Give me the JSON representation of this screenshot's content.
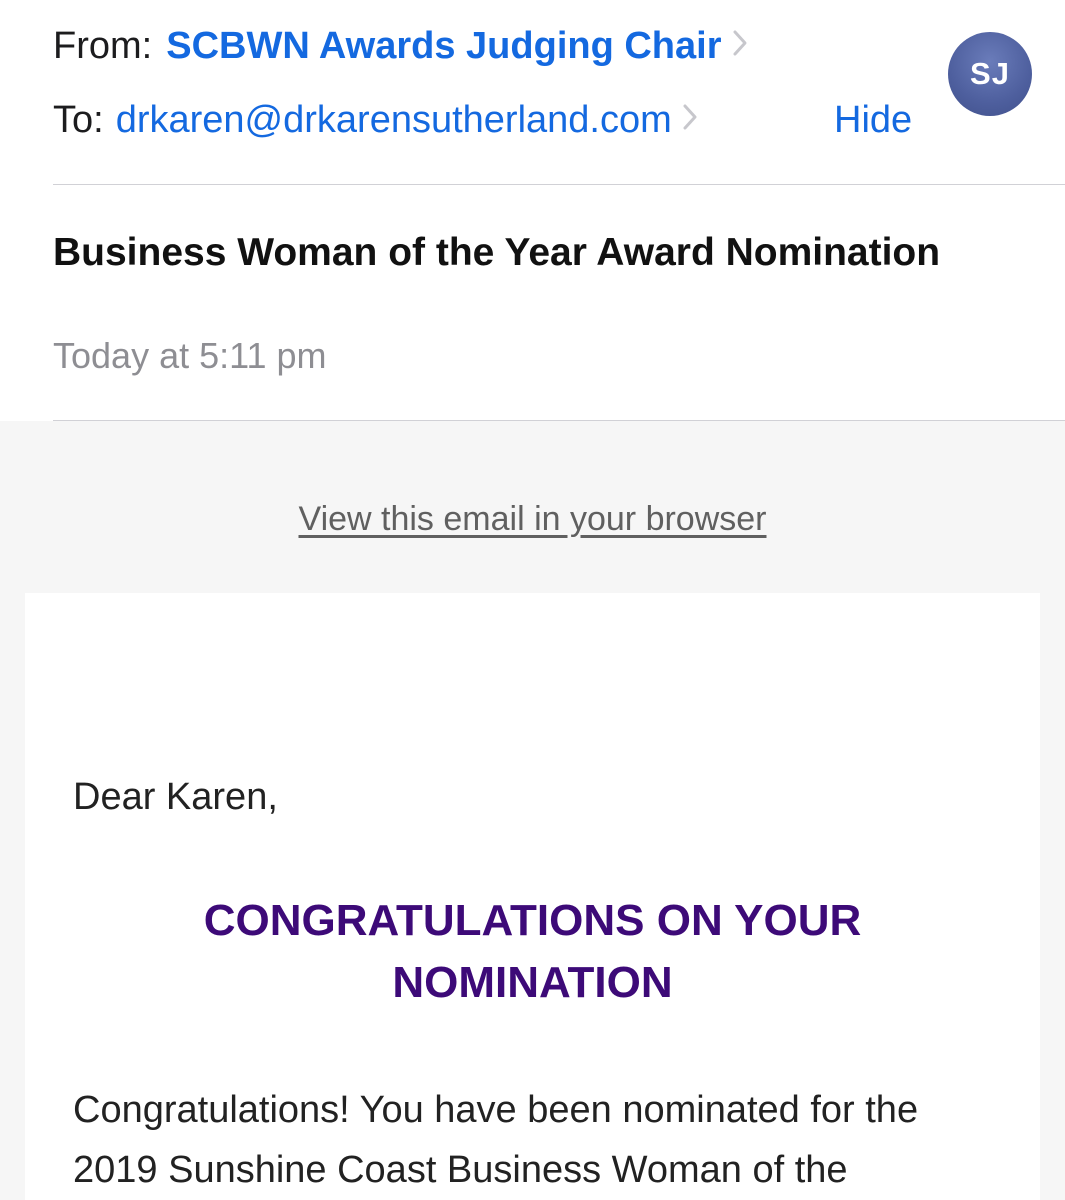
{
  "header": {
    "from_label": "From:",
    "sender_name": "SCBWN Awards Judging Chair",
    "to_label": "To:",
    "recipient": "drkaren@drkarensutherland.com",
    "hide_label": "Hide",
    "avatar_initials": "SJ",
    "subject": "Business Woman of the Year Award Nomination",
    "date": "Today at 5:11 pm"
  },
  "email": {
    "view_in_browser": "View this email in your browser",
    "greeting": "Dear Karen,",
    "headline": "CONGRATULATIONS ON YOUR NOMINATION",
    "body": "Congratulations! You have been nominated for the 2019 Sunshine Coast Business Woman of the"
  },
  "colors": {
    "link_blue": "#1469e0",
    "headline_purple": "#3d0a78",
    "avatar_bg": "#4e5f9e",
    "date_gray": "#8e8e93"
  },
  "icons": {
    "disclosure": "chevron-right-icon"
  }
}
